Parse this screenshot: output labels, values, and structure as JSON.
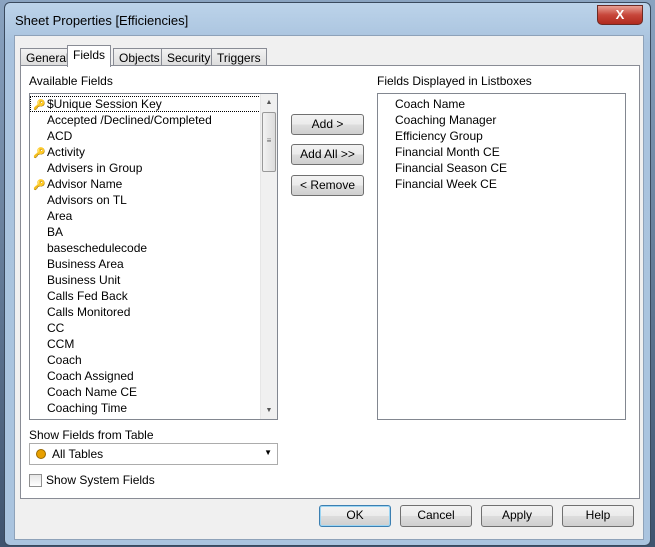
{
  "window": {
    "title": "Sheet Properties [Efficiencies]",
    "close_label": "X"
  },
  "tabs": [
    {
      "label": "General"
    },
    {
      "label": "Fields"
    },
    {
      "label": "Objects"
    },
    {
      "label": "Security"
    },
    {
      "label": "Triggers"
    }
  ],
  "active_tab": "Fields",
  "available": {
    "label": "Available Fields",
    "items": [
      {
        "label": "$Unique Session Key",
        "key": true
      },
      {
        "label": "Accepted /Declined/Completed"
      },
      {
        "label": "ACD"
      },
      {
        "label": "Activity",
        "key": true
      },
      {
        "label": "Advisers in Group"
      },
      {
        "label": "Advisor Name",
        "key": true
      },
      {
        "label": "Advisors on TL"
      },
      {
        "label": "Area"
      },
      {
        "label": "BA"
      },
      {
        "label": "baseschedulecode"
      },
      {
        "label": "Business Area"
      },
      {
        "label": "Business Unit"
      },
      {
        "label": "Calls Fed Back"
      },
      {
        "label": "Calls Monitored"
      },
      {
        "label": "CC"
      },
      {
        "label": "CCM"
      },
      {
        "label": "Coach"
      },
      {
        "label": "Coach Assigned"
      },
      {
        "label": "Coach Name CE"
      },
      {
        "label": "Coaching Time"
      }
    ]
  },
  "displayed": {
    "label": "Fields Displayed in Listboxes",
    "items": [
      "Coach Name",
      "Coaching Manager",
      "Efficiency Group",
      "Financial Month CE",
      "Financial Season CE",
      "Financial Week CE"
    ]
  },
  "buttons": {
    "add": "Add >",
    "add_all": "Add All >>",
    "remove": "< Remove",
    "ok": "OK",
    "cancel": "Cancel",
    "apply": "Apply",
    "help": "Help"
  },
  "table_select": {
    "label": "Show Fields from Table",
    "value": "All Tables"
  },
  "system_fields": {
    "label": "Show System Fields",
    "checked": false
  },
  "colors": {
    "key_icon": "#c49a2c",
    "table_dot": "#e8a000"
  }
}
